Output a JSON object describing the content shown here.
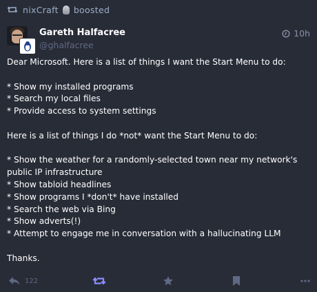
{
  "boost": {
    "booster": "nixCraft",
    "label": "boosted"
  },
  "author": {
    "display_name": "Gareth Halfacree",
    "handle": "@ghalfacree"
  },
  "timestamp": "10h",
  "content": {
    "greeting": "Dear Microsoft. Here is a list of things I want the Start Menu to do:",
    "wants": [
      "* Show my installed programs",
      "* Search my local files",
      "* Provide access to system settings"
    ],
    "intro_not": "Here is a list of things I do *not* want the Start Menu to do:",
    "not_wants": [
      "* Show the weather for a randomly-selected town near my network's public IP infrastructure",
      "* Show tabloid headlines",
      "* Show programs I *don't* have installed",
      "* Search the web via Bing",
      "* Show adverts(!)",
      "* Attempt to engage me in conversation with a hallucinating LLM"
    ],
    "signoff": "Thanks."
  },
  "actions": {
    "reply_count": "122",
    "icons": [
      "reply-icon",
      "boost-icon",
      "favourite-icon",
      "bookmark-icon",
      "more-icon"
    ]
  },
  "colors": {
    "background": "#282c37",
    "muted_text": "#9baec8",
    "handle_text": "#606984",
    "boost_active": "#8c8dff",
    "action_icon": "#606984"
  }
}
